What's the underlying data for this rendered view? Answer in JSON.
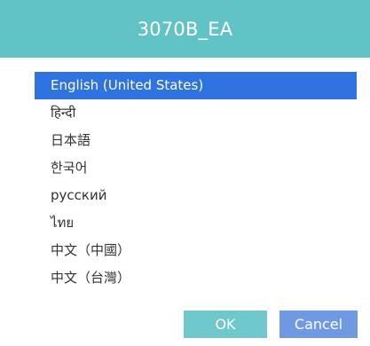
{
  "dialog": {
    "title": "3070B_EA",
    "languages": [
      {
        "label": "English (United States)",
        "selected": true
      },
      {
        "label": "हिन्दी",
        "selected": false
      },
      {
        "label": "日本語",
        "selected": false
      },
      {
        "label": "한국어",
        "selected": false
      },
      {
        "label": "русский",
        "selected": false
      },
      {
        "label": "ไทย",
        "selected": false
      },
      {
        "label": "中文（中國）",
        "selected": false
      },
      {
        "label": "中文（台灣）",
        "selected": false
      }
    ],
    "ok_label": "OK",
    "cancel_label": "Cancel"
  },
  "colors": {
    "title_bar": "#62c3c6",
    "selected_row": "#2f73e0",
    "ok_button": "#6fc8cb",
    "cancel_button": "#6f99e3"
  }
}
